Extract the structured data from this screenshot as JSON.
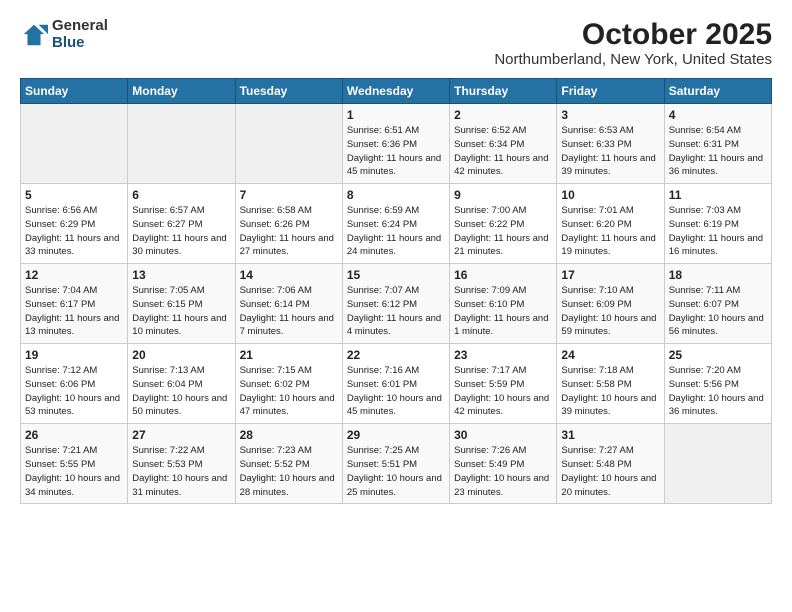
{
  "logo": {
    "general": "General",
    "blue": "Blue"
  },
  "title": "October 2025",
  "location": "Northumberland, New York, United States",
  "days_header": [
    "Sunday",
    "Monday",
    "Tuesday",
    "Wednesday",
    "Thursday",
    "Friday",
    "Saturday"
  ],
  "weeks": [
    [
      {
        "day": "",
        "info": ""
      },
      {
        "day": "",
        "info": ""
      },
      {
        "day": "",
        "info": ""
      },
      {
        "day": "1",
        "info": "Sunrise: 6:51 AM\nSunset: 6:36 PM\nDaylight: 11 hours and 45 minutes."
      },
      {
        "day": "2",
        "info": "Sunrise: 6:52 AM\nSunset: 6:34 PM\nDaylight: 11 hours and 42 minutes."
      },
      {
        "day": "3",
        "info": "Sunrise: 6:53 AM\nSunset: 6:33 PM\nDaylight: 11 hours and 39 minutes."
      },
      {
        "day": "4",
        "info": "Sunrise: 6:54 AM\nSunset: 6:31 PM\nDaylight: 11 hours and 36 minutes."
      }
    ],
    [
      {
        "day": "5",
        "info": "Sunrise: 6:56 AM\nSunset: 6:29 PM\nDaylight: 11 hours and 33 minutes."
      },
      {
        "day": "6",
        "info": "Sunrise: 6:57 AM\nSunset: 6:27 PM\nDaylight: 11 hours and 30 minutes."
      },
      {
        "day": "7",
        "info": "Sunrise: 6:58 AM\nSunset: 6:26 PM\nDaylight: 11 hours and 27 minutes."
      },
      {
        "day": "8",
        "info": "Sunrise: 6:59 AM\nSunset: 6:24 PM\nDaylight: 11 hours and 24 minutes."
      },
      {
        "day": "9",
        "info": "Sunrise: 7:00 AM\nSunset: 6:22 PM\nDaylight: 11 hours and 21 minutes."
      },
      {
        "day": "10",
        "info": "Sunrise: 7:01 AM\nSunset: 6:20 PM\nDaylight: 11 hours and 19 minutes."
      },
      {
        "day": "11",
        "info": "Sunrise: 7:03 AM\nSunset: 6:19 PM\nDaylight: 11 hours and 16 minutes."
      }
    ],
    [
      {
        "day": "12",
        "info": "Sunrise: 7:04 AM\nSunset: 6:17 PM\nDaylight: 11 hours and 13 minutes."
      },
      {
        "day": "13",
        "info": "Sunrise: 7:05 AM\nSunset: 6:15 PM\nDaylight: 11 hours and 10 minutes."
      },
      {
        "day": "14",
        "info": "Sunrise: 7:06 AM\nSunset: 6:14 PM\nDaylight: 11 hours and 7 minutes."
      },
      {
        "day": "15",
        "info": "Sunrise: 7:07 AM\nSunset: 6:12 PM\nDaylight: 11 hours and 4 minutes."
      },
      {
        "day": "16",
        "info": "Sunrise: 7:09 AM\nSunset: 6:10 PM\nDaylight: 11 hours and 1 minute."
      },
      {
        "day": "17",
        "info": "Sunrise: 7:10 AM\nSunset: 6:09 PM\nDaylight: 10 hours and 59 minutes."
      },
      {
        "day": "18",
        "info": "Sunrise: 7:11 AM\nSunset: 6:07 PM\nDaylight: 10 hours and 56 minutes."
      }
    ],
    [
      {
        "day": "19",
        "info": "Sunrise: 7:12 AM\nSunset: 6:06 PM\nDaylight: 10 hours and 53 minutes."
      },
      {
        "day": "20",
        "info": "Sunrise: 7:13 AM\nSunset: 6:04 PM\nDaylight: 10 hours and 50 minutes."
      },
      {
        "day": "21",
        "info": "Sunrise: 7:15 AM\nSunset: 6:02 PM\nDaylight: 10 hours and 47 minutes."
      },
      {
        "day": "22",
        "info": "Sunrise: 7:16 AM\nSunset: 6:01 PM\nDaylight: 10 hours and 45 minutes."
      },
      {
        "day": "23",
        "info": "Sunrise: 7:17 AM\nSunset: 5:59 PM\nDaylight: 10 hours and 42 minutes."
      },
      {
        "day": "24",
        "info": "Sunrise: 7:18 AM\nSunset: 5:58 PM\nDaylight: 10 hours and 39 minutes."
      },
      {
        "day": "25",
        "info": "Sunrise: 7:20 AM\nSunset: 5:56 PM\nDaylight: 10 hours and 36 minutes."
      }
    ],
    [
      {
        "day": "26",
        "info": "Sunrise: 7:21 AM\nSunset: 5:55 PM\nDaylight: 10 hours and 34 minutes."
      },
      {
        "day": "27",
        "info": "Sunrise: 7:22 AM\nSunset: 5:53 PM\nDaylight: 10 hours and 31 minutes."
      },
      {
        "day": "28",
        "info": "Sunrise: 7:23 AM\nSunset: 5:52 PM\nDaylight: 10 hours and 28 minutes."
      },
      {
        "day": "29",
        "info": "Sunrise: 7:25 AM\nSunset: 5:51 PM\nDaylight: 10 hours and 25 minutes."
      },
      {
        "day": "30",
        "info": "Sunrise: 7:26 AM\nSunset: 5:49 PM\nDaylight: 10 hours and 23 minutes."
      },
      {
        "day": "31",
        "info": "Sunrise: 7:27 AM\nSunset: 5:48 PM\nDaylight: 10 hours and 20 minutes."
      },
      {
        "day": "",
        "info": ""
      }
    ]
  ]
}
